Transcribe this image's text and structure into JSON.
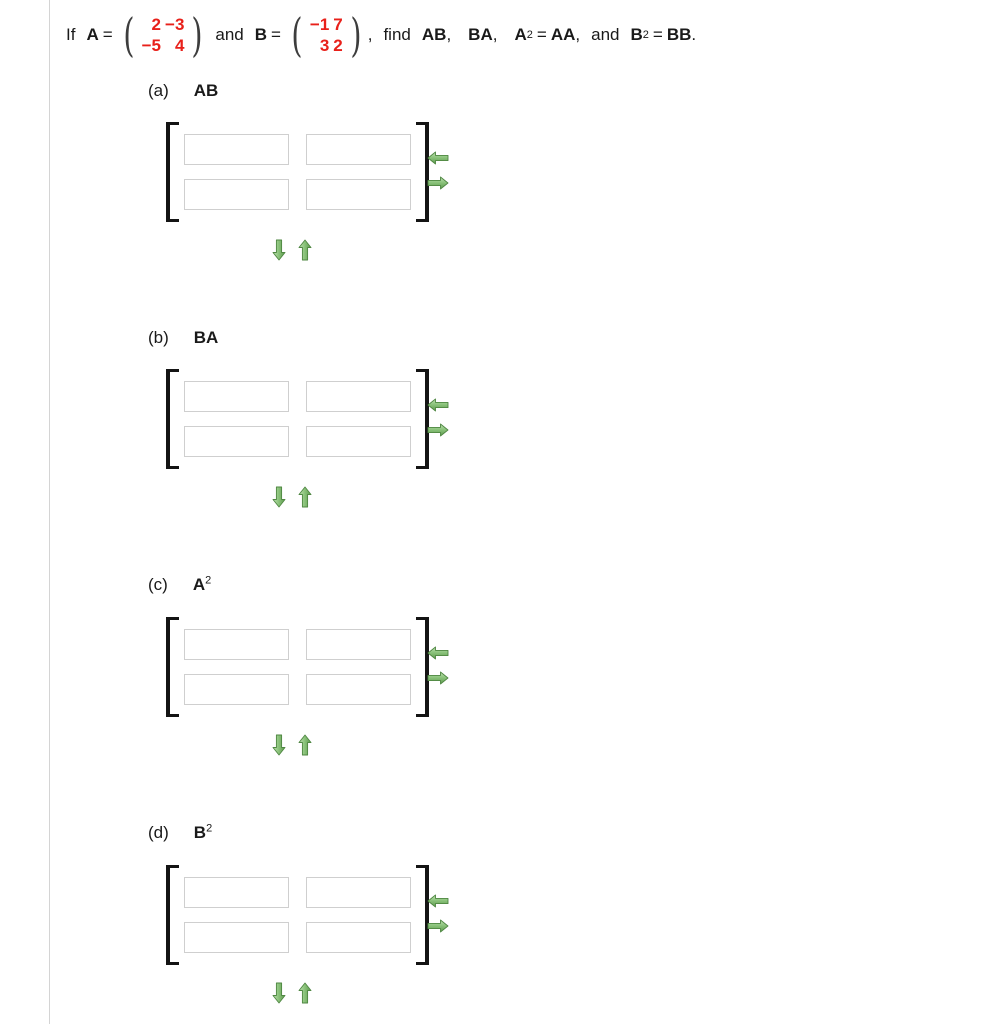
{
  "question": {
    "lead": "If",
    "var_a": "A",
    "equals": "=",
    "matrix_a": {
      "rows": [
        [
          "2",
          "−3"
        ],
        [
          "−5",
          "4"
        ]
      ],
      "color": "#e8201a"
    },
    "conj": "and",
    "var_b": "B",
    "matrix_b": {
      "rows": [
        [
          "−1",
          "7"
        ],
        [
          "3",
          "2"
        ]
      ],
      "color": "#e8201a"
    },
    "comma": ",",
    "find": "find",
    "terms": [
      {
        "base": "AB",
        "sup": "",
        "tail": ","
      },
      {
        "base": "BA",
        "sup": "",
        "tail": ","
      },
      {
        "base": "A",
        "sup": "2",
        "eq": "=",
        "rhs": "AA",
        "tail": ","
      }
    ],
    "and_word": "and",
    "last_term": {
      "base": "B",
      "sup": "2",
      "eq": "=",
      "rhs": "BB",
      "tail": "."
    }
  },
  "parts": [
    {
      "letter": "(a)",
      "expr_base": "AB",
      "expr_sup": "",
      "cells": [
        {
          "value": "",
          "placeholder": ""
        },
        {
          "value": "",
          "placeholder": ""
        },
        {
          "value": "",
          "placeholder": ""
        },
        {
          "value": "",
          "placeholder": ""
        }
      ],
      "side_arrows": [
        "left-arrow-icon",
        "right-arrow-icon"
      ],
      "bottom_arrows": [
        "down-arrow-icon",
        "up-arrow-icon"
      ]
    },
    {
      "letter": "(b)",
      "expr_base": "BA",
      "expr_sup": "",
      "cells": [
        {
          "value": "",
          "placeholder": ""
        },
        {
          "value": "",
          "placeholder": ""
        },
        {
          "value": "",
          "placeholder": ""
        },
        {
          "value": "",
          "placeholder": ""
        }
      ],
      "side_arrows": [
        "left-arrow-icon",
        "right-arrow-icon"
      ],
      "bottom_arrows": [
        "down-arrow-icon",
        "up-arrow-icon"
      ]
    },
    {
      "letter": "(c)",
      "expr_base": "A",
      "expr_sup": "2",
      "cells": [
        {
          "value": "",
          "placeholder": ""
        },
        {
          "value": "",
          "placeholder": ""
        },
        {
          "value": "",
          "placeholder": ""
        },
        {
          "value": "",
          "placeholder": ""
        }
      ],
      "side_arrows": [
        "left-arrow-icon",
        "right-arrow-icon"
      ],
      "bottom_arrows": [
        "down-arrow-icon",
        "up-arrow-icon"
      ]
    },
    {
      "letter": "(d)",
      "expr_base": "B",
      "expr_sup": "2",
      "cells": [
        {
          "value": "",
          "placeholder": ""
        },
        {
          "value": "",
          "placeholder": ""
        },
        {
          "value": "",
          "placeholder": ""
        },
        {
          "value": "",
          "placeholder": ""
        }
      ],
      "side_arrows": [
        "left-arrow-icon",
        "right-arrow-icon"
      ],
      "bottom_arrows": [
        "down-arrow-icon",
        "up-arrow-icon"
      ]
    }
  ],
  "colors": {
    "matrix_red": "#e8201a",
    "arrow_green": "#8cc47c",
    "arrow_green_dark": "#5e9a4e",
    "bracket": "#141414",
    "input_border": "#cfcfcf",
    "rule": "#d4d4d4"
  }
}
